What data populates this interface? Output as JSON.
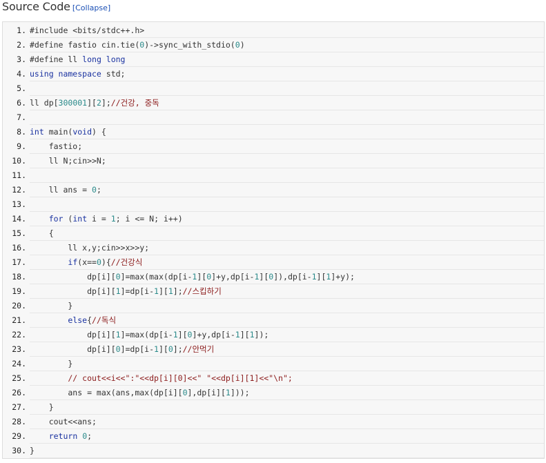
{
  "header": {
    "title": "Source Code",
    "collapse_label": "[Collapse]"
  },
  "code": {
    "lines": [
      {
        "n": "1.",
        "seg": [
          [
            "pre",
            "#include <bits/stdc++.h>"
          ]
        ]
      },
      {
        "n": "2.",
        "seg": [
          [
            "pre",
            "#define fastio cin.tie("
          ],
          [
            "num",
            "0"
          ],
          [
            "pre",
            ")->sync_with_stdio("
          ],
          [
            "num",
            "0"
          ],
          [
            "pre",
            ")"
          ]
        ]
      },
      {
        "n": "3.",
        "seg": [
          [
            "pre",
            "#define ll "
          ],
          [
            "ty",
            "long long"
          ]
        ]
      },
      {
        "n": "4.",
        "seg": [
          [
            "kw",
            "using namespace"
          ],
          [
            "",
            " std;"
          ]
        ]
      },
      {
        "n": "5.",
        "seg": []
      },
      {
        "n": "6.",
        "seg": [
          [
            "",
            "ll dp["
          ],
          [
            "num",
            "300001"
          ],
          [
            "",
            "]["
          ],
          [
            "num",
            "2"
          ],
          [
            "",
            "];"
          ],
          [
            "cm",
            "//건강, 중독"
          ]
        ]
      },
      {
        "n": "7.",
        "seg": []
      },
      {
        "n": "8.",
        "seg": [
          [
            "ty",
            "int"
          ],
          [
            "",
            " main("
          ],
          [
            "ty",
            "void"
          ],
          [
            "",
            ") {"
          ]
        ]
      },
      {
        "n": "9.",
        "seg": [
          [
            "",
            "    fastio;"
          ]
        ]
      },
      {
        "n": "10.",
        "seg": [
          [
            "",
            "    ll N;cin>>N;"
          ]
        ]
      },
      {
        "n": "11.",
        "seg": []
      },
      {
        "n": "12.",
        "seg": [
          [
            "",
            "    ll ans = "
          ],
          [
            "num",
            "0"
          ],
          [
            "",
            ";"
          ]
        ]
      },
      {
        "n": "13.",
        "seg": []
      },
      {
        "n": "14.",
        "seg": [
          [
            "",
            "    "
          ],
          [
            "kw",
            "for"
          ],
          [
            "",
            " ("
          ],
          [
            "ty",
            "int"
          ],
          [
            "",
            " i = "
          ],
          [
            "num",
            "1"
          ],
          [
            "",
            "; i <= N; i++)"
          ]
        ]
      },
      {
        "n": "15.",
        "seg": [
          [
            "",
            "    {"
          ]
        ]
      },
      {
        "n": "16.",
        "seg": [
          [
            "",
            "        ll x,y;cin>>x>>y;"
          ]
        ]
      },
      {
        "n": "17.",
        "seg": [
          [
            "",
            "        "
          ],
          [
            "kw",
            "if"
          ],
          [
            "",
            "(x=="
          ],
          [
            "num",
            "0"
          ],
          [
            "",
            "){"
          ],
          [
            "cm",
            "//건강식"
          ]
        ]
      },
      {
        "n": "18.",
        "seg": [
          [
            "",
            "            dp[i]["
          ],
          [
            "num",
            "0"
          ],
          [
            "",
            "]=max(max(dp[i-"
          ],
          [
            "num",
            "1"
          ],
          [
            "",
            "]["
          ],
          [
            "num",
            "0"
          ],
          [
            "",
            "]+y,dp[i-"
          ],
          [
            "num",
            "1"
          ],
          [
            "",
            "]["
          ],
          [
            "num",
            "0"
          ],
          [
            "",
            "]),dp[i-"
          ],
          [
            "num",
            "1"
          ],
          [
            "",
            "]["
          ],
          [
            "num",
            "1"
          ],
          [
            "",
            "]+y);"
          ]
        ]
      },
      {
        "n": "19.",
        "seg": [
          [
            "",
            "            dp[i]["
          ],
          [
            "num",
            "1"
          ],
          [
            "",
            "]=dp[i-"
          ],
          [
            "num",
            "1"
          ],
          [
            "",
            "]["
          ],
          [
            "num",
            "1"
          ],
          [
            "",
            "];"
          ],
          [
            "cm",
            "//스킵하기"
          ]
        ]
      },
      {
        "n": "20.",
        "seg": [
          [
            "",
            "        }"
          ]
        ]
      },
      {
        "n": "21.",
        "seg": [
          [
            "",
            "        "
          ],
          [
            "kw",
            "else"
          ],
          [
            "",
            "{"
          ],
          [
            "cm",
            "//독식"
          ]
        ]
      },
      {
        "n": "22.",
        "seg": [
          [
            "",
            "            dp[i]["
          ],
          [
            "num",
            "1"
          ],
          [
            "",
            "]=max(dp[i-"
          ],
          [
            "num",
            "1"
          ],
          [
            "",
            "]["
          ],
          [
            "num",
            "0"
          ],
          [
            "",
            "]+y,dp[i-"
          ],
          [
            "num",
            "1"
          ],
          [
            "",
            "]["
          ],
          [
            "num",
            "1"
          ],
          [
            "",
            "]);"
          ]
        ]
      },
      {
        "n": "23.",
        "seg": [
          [
            "",
            "            dp[i]["
          ],
          [
            "num",
            "0"
          ],
          [
            "",
            "]=dp[i-"
          ],
          [
            "num",
            "1"
          ],
          [
            "",
            "]["
          ],
          [
            "num",
            "0"
          ],
          [
            "",
            "];"
          ],
          [
            "cm",
            "//안먹기"
          ]
        ]
      },
      {
        "n": "24.",
        "seg": [
          [
            "",
            "        }"
          ]
        ]
      },
      {
        "n": "25.",
        "seg": [
          [
            "cm",
            "        // cout<<i<<\":\"<<dp[i][0]<<\" \"<<dp[i][1]<<\"\\n\";"
          ]
        ]
      },
      {
        "n": "26.",
        "seg": [
          [
            "",
            "        ans = max(ans,max(dp[i]["
          ],
          [
            "num",
            "0"
          ],
          [
            "",
            "],dp[i]["
          ],
          [
            "num",
            "1"
          ],
          [
            "",
            "]));"
          ]
        ]
      },
      {
        "n": "27.",
        "seg": [
          [
            "",
            "    }"
          ]
        ]
      },
      {
        "n": "28.",
        "seg": [
          [
            "",
            "    cout<<ans;"
          ]
        ]
      },
      {
        "n": "29.",
        "seg": [
          [
            "",
            "    "
          ],
          [
            "kw",
            "return"
          ],
          [
            "",
            " "
          ],
          [
            "num",
            "0"
          ],
          [
            "",
            ";"
          ]
        ]
      },
      {
        "n": "30.",
        "seg": [
          [
            "",
            "}"
          ]
        ]
      }
    ]
  },
  "colors": {
    "keyword": "#1a32a0",
    "number": "#2a8a8a",
    "comment": "#8b1a1a",
    "text": "#333333",
    "link": "#1a4fb5",
    "code_bg": "#f7f7f7"
  }
}
